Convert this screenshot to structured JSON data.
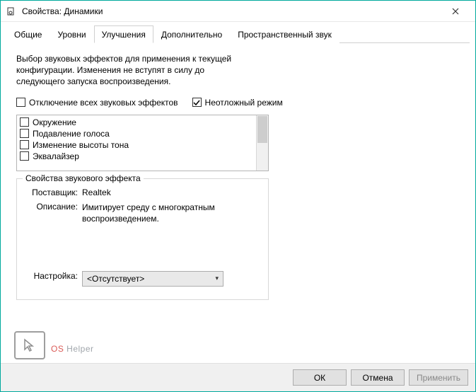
{
  "window": {
    "title": "Свойства: Динамики"
  },
  "tabs": [
    {
      "label": "Общие"
    },
    {
      "label": "Уровни"
    },
    {
      "label": "Улучшения"
    },
    {
      "label": "Дополнительно"
    },
    {
      "label": "Пространственный звук"
    }
  ],
  "enh": {
    "description": "Выбор звуковых эффектов для применения к текущей конфигурации. Изменения не вступят в силу до следующего запуска воспроизведения.",
    "disable_all_label": "Отключение всех звуковых эффектов",
    "immediate_mode_label": "Неотложный режим",
    "effects": [
      {
        "label": "Окружение"
      },
      {
        "label": "Подавление голоса"
      },
      {
        "label": "Изменение высоты тона"
      },
      {
        "label": "Эквалайзер"
      }
    ],
    "props": {
      "legend": "Свойства звукового эффекта",
      "vendor_label": "Поставщик:",
      "vendor_value": "Realtek",
      "desc_label": "Описание:",
      "desc_value": "Имитирует среду с многократным воспроизведением.",
      "setting_label": "Настройка:",
      "setting_value": "<Отсутствует>"
    }
  },
  "buttons": {
    "ok": "ОК",
    "cancel": "Отмена",
    "apply": "Применить"
  },
  "watermark": {
    "os": "OS",
    "helper": " Helper"
  }
}
